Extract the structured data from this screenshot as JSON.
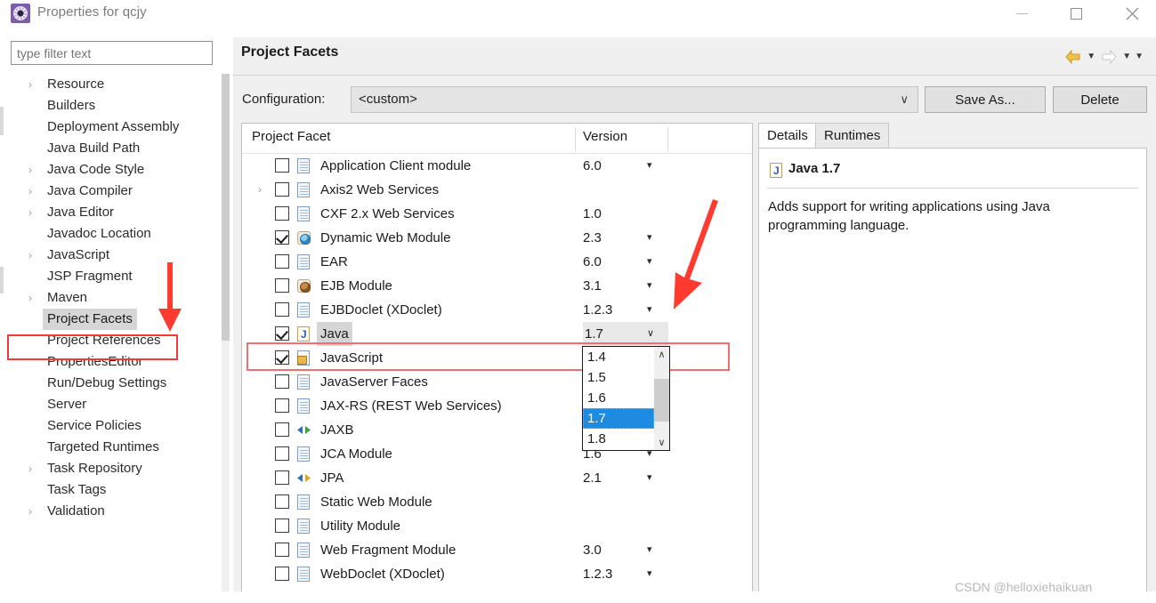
{
  "window": {
    "title": "Properties for qcjy",
    "app_icon": "gear-icon",
    "minimize_label": "—",
    "maximize_label": "☐",
    "close_label": "✕"
  },
  "sidebar": {
    "filter_value": "",
    "filter_placeholder": "type filter text",
    "items": [
      {
        "label": "Resource",
        "expandable": true,
        "selected": false
      },
      {
        "label": "Builders",
        "expandable": false,
        "selected": false
      },
      {
        "label": "Deployment Assembly",
        "expandable": false,
        "selected": false
      },
      {
        "label": "Java Build Path",
        "expandable": false,
        "selected": false
      },
      {
        "label": "Java Code Style",
        "expandable": true,
        "selected": false
      },
      {
        "label": "Java Compiler",
        "expandable": true,
        "selected": false
      },
      {
        "label": "Java Editor",
        "expandable": true,
        "selected": false
      },
      {
        "label": "Javadoc Location",
        "expandable": false,
        "selected": false
      },
      {
        "label": "JavaScript",
        "expandable": true,
        "selected": false
      },
      {
        "label": "JSP Fragment",
        "expandable": false,
        "selected": false
      },
      {
        "label": "Maven",
        "expandable": true,
        "selected": false
      },
      {
        "label": "Project Facets",
        "expandable": false,
        "selected": true
      },
      {
        "label": "Project References",
        "expandable": false,
        "selected": false
      },
      {
        "label": "PropertiesEditor",
        "expandable": false,
        "selected": false
      },
      {
        "label": "Run/Debug Settings",
        "expandable": false,
        "selected": false
      },
      {
        "label": "Server",
        "expandable": false,
        "selected": false
      },
      {
        "label": "Service Policies",
        "expandable": false,
        "selected": false
      },
      {
        "label": "Targeted Runtimes",
        "expandable": false,
        "selected": false
      },
      {
        "label": "Task Repository",
        "expandable": true,
        "selected": false
      },
      {
        "label": "Task Tags",
        "expandable": false,
        "selected": false
      },
      {
        "label": "Validation",
        "expandable": true,
        "selected": false
      }
    ]
  },
  "header": {
    "page_title": "Project Facets",
    "back_arrow": "back-arrow-icon",
    "forward_arrow": "forward-arrow-icon",
    "menu_caret": "▼"
  },
  "config": {
    "label": "Configuration:",
    "value": "<custom>",
    "caret": "∨",
    "save_as_label": "Save As...",
    "delete_label": "Delete"
  },
  "facet_table": {
    "col_facet": "Project Facet",
    "col_version": "Version",
    "rows": [
      {
        "name": "Application Client module",
        "version": "6.0",
        "checked": false,
        "expandable": false,
        "icon": "document-icon",
        "caret": true
      },
      {
        "name": "Axis2 Web Services",
        "version": "",
        "checked": false,
        "expandable": true,
        "icon": "document-icon",
        "caret": false
      },
      {
        "name": "CXF 2.x Web Services",
        "version": "1.0",
        "checked": false,
        "expandable": false,
        "icon": "document-icon",
        "caret": false
      },
      {
        "name": "Dynamic Web Module",
        "version": "2.3",
        "checked": true,
        "expandable": false,
        "icon": "web-module-icon",
        "caret": true
      },
      {
        "name": "EAR",
        "version": "6.0",
        "checked": false,
        "expandable": false,
        "icon": "document-icon",
        "caret": true
      },
      {
        "name": "EJB Module",
        "version": "3.1",
        "checked": false,
        "expandable": false,
        "icon": "ejb-module-icon",
        "caret": true
      },
      {
        "name": "EJBDoclet (XDoclet)",
        "version": "1.2.3",
        "checked": false,
        "expandable": false,
        "icon": "document-icon",
        "caret": true
      },
      {
        "name": "Java",
        "version": "1.7",
        "checked": true,
        "expandable": false,
        "icon": "java-icon",
        "caret": false,
        "selected": true
      },
      {
        "name": "JavaScript",
        "version": "",
        "checked": true,
        "expandable": false,
        "icon": "javascript-icon",
        "caret": false
      },
      {
        "name": "JavaServer Faces",
        "version": "",
        "checked": false,
        "expandable": false,
        "icon": "document-icon",
        "caret": false
      },
      {
        "name": "JAX-RS (REST Web Services)",
        "version": "",
        "checked": false,
        "expandable": false,
        "icon": "document-icon",
        "caret": false
      },
      {
        "name": "JAXB",
        "version": "",
        "checked": false,
        "expandable": false,
        "icon": "jaxb-arrows-icon",
        "caret": false
      },
      {
        "name": "JCA Module",
        "version": "1.6",
        "checked": false,
        "expandable": false,
        "icon": "document-icon",
        "caret": true
      },
      {
        "name": "JPA",
        "version": "2.1",
        "checked": false,
        "expandable": false,
        "icon": "jpa-arrows-icon",
        "caret": true
      },
      {
        "name": "Static Web Module",
        "version": "",
        "checked": false,
        "expandable": false,
        "icon": "document-icon",
        "caret": false
      },
      {
        "name": "Utility Module",
        "version": "",
        "checked": false,
        "expandable": false,
        "icon": "document-icon",
        "caret": false
      },
      {
        "name": "Web Fragment Module",
        "version": "3.0",
        "checked": false,
        "expandable": false,
        "icon": "document-icon",
        "caret": true
      },
      {
        "name": "WebDoclet (XDoclet)",
        "version": "1.2.3",
        "checked": false,
        "expandable": false,
        "icon": "document-icon",
        "caret": true
      }
    ]
  },
  "version_dropdown": {
    "open": true,
    "selected": "1.7",
    "options": [
      "1.4",
      "1.5",
      "1.6",
      "1.7",
      "1.8"
    ],
    "scroll_up": "∧",
    "scroll_down": "∨"
  },
  "details": {
    "tabs": [
      {
        "label": "Details",
        "active": true
      },
      {
        "label": "Runtimes",
        "active": false
      }
    ],
    "icon": "java-icon",
    "title": "Java 1.7",
    "description": "Adds support for writing applications using Java programming language."
  },
  "annotations": {
    "arrow_down_color": "#ff3b30",
    "arrow_diagonal_color": "#ff3b30",
    "tree_box_color": "#ef3b3b",
    "row_box_color": "#f07070"
  },
  "watermark": "CSDN @helloxiehaikuan"
}
